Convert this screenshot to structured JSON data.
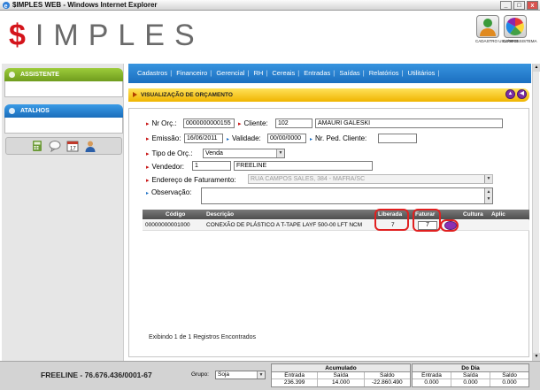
{
  "window": {
    "title": "$IMPLES WEB - Windows Internet Explorer",
    "min": "_",
    "max": "□",
    "close": "x"
  },
  "brand": {
    "dollar": "$",
    "rest": "IMPLES"
  },
  "top_icons": [
    {
      "label": "CADASTRO USUÁRIOS"
    },
    {
      "label": "CONFIG SISTEMA"
    }
  ],
  "left_panel": {
    "assistente": "ASSISTENTE",
    "atalhos": "ATALHOS"
  },
  "menu": [
    "Cadastros",
    "Financeiro",
    "Gerencial",
    "RH",
    "Cereais",
    "Entradas",
    "Saídas",
    "Relatórios",
    "Utilitários"
  ],
  "menu_sep": "|",
  "section": {
    "title": "VISUALIZAÇÃO DE ORÇAMENTO",
    "prev": "▲",
    "next": "◀"
  },
  "form": {
    "nr_orc_label": "Nr Orç.:",
    "nr_orc_value": "0000000000155",
    "cliente_label": "Cliente:",
    "cliente_code": "102",
    "cliente_name": "AMAURI GALESKI",
    "emissao_label": "Emissão:",
    "emissao_value": "16/06/2011",
    "validade_label": "Validade:",
    "validade_value": "00/00/0000",
    "nr_ped_label": "Nr. Ped. Cliente:",
    "nr_ped_value": "",
    "tipo_label": "Tipo de Orç.:",
    "tipo_value": "Venda",
    "vendedor_label": "Vendedor:",
    "vendedor_code": "1",
    "vendedor_name": "FREELINE",
    "endereco_label": "Endereço de Faturamento:",
    "endereco_value": "RUA CAMPOS SALES, 384 - MAFRA/SC",
    "obs_label": "Observação:",
    "obs_value": ""
  },
  "grid": {
    "headers": {
      "codigo": "Código",
      "descricao": "Descrição",
      "liberada": "Liberada",
      "faturar": "Faturar",
      "cultura": "Cultura",
      "aplic": "Aplic"
    },
    "rows": [
      {
        "codigo": "00000000001000",
        "descricao": "CONEXÃO DE PLÁSTICO A T-TAPE LAYF 500-00 LFT NCM",
        "liberada": "7",
        "faturar": "7"
      }
    ],
    "footer": "Exibindo 1 de 1 Registros Encontrados"
  },
  "status": {
    "company": "FREELINE - 76.676.436/0001-67",
    "grupo_label": "Grupo:",
    "grupo_value": "Soja",
    "acumulado": {
      "title": "Acumulado",
      "cols": [
        "Entrada",
        "Saída",
        "Saldo"
      ],
      "vals": [
        "236.399",
        "14.000",
        "-22.860.490"
      ]
    },
    "dodia": {
      "title": "Do Dia",
      "cols": [
        "Entrada",
        "Saída",
        "Saldo"
      ],
      "vals": [
        "0.000",
        "0.000",
        "0.000"
      ]
    }
  },
  "colors": {
    "accent_blue": "#1c6fc0",
    "accent_green": "#6f9c1e",
    "section_yellow": "#f0b400",
    "brand_red": "#d4141b",
    "highlight_red": "#e02020"
  }
}
